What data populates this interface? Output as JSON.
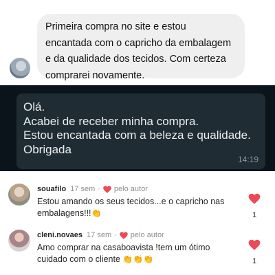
{
  "dm": {
    "lines": [
      "Primeira compra no site e estou",
      "encantada com o capricho da embalagem",
      "e da qualidade dos tecidos. Com certeza",
      "comprarei novamente."
    ]
  },
  "whatsapp": {
    "lines": [
      "Olá.",
      "Acabei  de receber  minha compra.",
      "Estou encantada com a beleza e qualidade.",
      "Obrigada"
    ],
    "time": "14:19"
  },
  "comments": [
    {
      "username": "souafilo",
      "age": "17 sem",
      "separator": "·",
      "badge": "pelo autor",
      "text_line1": "Estou amando os seus tecidos...e o capricho nas",
      "text_line2": "embalagens!!!",
      "emoji": "👏",
      "likes": "1"
    },
    {
      "username": "cleni.novaes",
      "age": "17 sem",
      "separator": "·",
      "badge": "pelo autor",
      "text_line1": "Amo comprar na casaboavista !tem um ótimo",
      "text_line2": "cuidado com o cliente",
      "emoji": "👏👏👏",
      "likes": "1"
    }
  ],
  "colors": {
    "heart": "#ed4956",
    "whatsapp_bg": "#0b141a",
    "whatsapp_bubble": "#202c33",
    "dm_bubble": "#efefef"
  },
  "icons": {
    "heart": "heart-icon"
  }
}
